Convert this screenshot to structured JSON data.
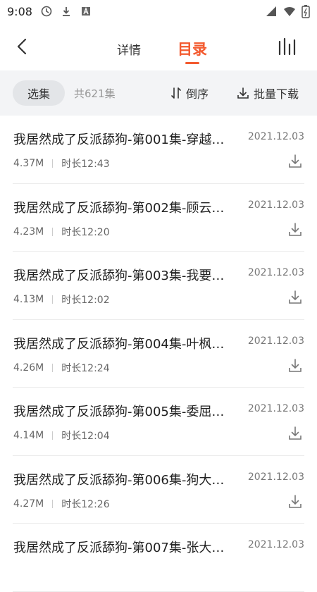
{
  "status_bar": {
    "time": "9:08"
  },
  "nav": {
    "tab_detail": "详情",
    "tab_catalog": "目录"
  },
  "filter": {
    "select_label": "选集",
    "total": "共621集",
    "sort_label": "倒序",
    "batch_label": "批量下载"
  },
  "episodes": [
    {
      "title": "我居然成了反派舔狗-第001集-穿越…",
      "date": "2021.12.03",
      "size": "4.37M",
      "duration": "时长12:43"
    },
    {
      "title": "我居然成了反派舔狗-第002集-顾云…",
      "date": "2021.12.03",
      "size": "4.23M",
      "duration": "时长12:20"
    },
    {
      "title": "我居然成了反派舔狗-第003集-我要…",
      "date": "2021.12.03",
      "size": "4.13M",
      "duration": "时长12:02"
    },
    {
      "title": "我居然成了反派舔狗-第004集-叶枫…",
      "date": "2021.12.03",
      "size": "4.26M",
      "duration": "时长12:24"
    },
    {
      "title": "我居然成了反派舔狗-第005集-委屈…",
      "date": "2021.12.03",
      "size": "4.14M",
      "duration": "时长12:04"
    },
    {
      "title": "我居然成了反派舔狗-第006集-狗大…",
      "date": "2021.12.03",
      "size": "4.27M",
      "duration": "时长12:26"
    },
    {
      "title": "我居然成了反派舔狗-第007集-张大…",
      "date": "2021.12.03",
      "size": "",
      "duration": ""
    }
  ],
  "colors": {
    "accent": "#f35a2f",
    "filter_bg": "#f3f4f6"
  },
  "icons": [
    "back-arrow-icon",
    "chart-bars-icon",
    "sort-icon",
    "download-icon"
  ]
}
